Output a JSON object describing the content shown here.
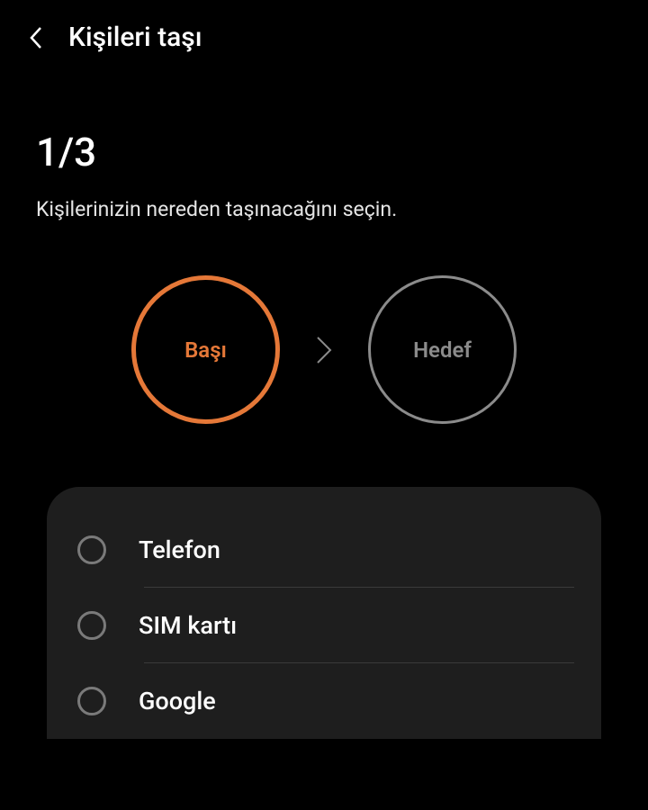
{
  "header": {
    "title": "Kişileri taşı"
  },
  "progress": {
    "step_counter": "1/3",
    "instruction": "Kişilerinizin nereden taşınacağını seçin."
  },
  "flow": {
    "source_label": "Başı",
    "target_label": "Hedef"
  },
  "options": [
    {
      "label": "Telefon"
    },
    {
      "label": "SIM kartı"
    },
    {
      "label": "Google"
    }
  ],
  "colors": {
    "accent": "#e57838",
    "inactive": "#8b8b8b",
    "panel": "#1e1e1e"
  }
}
